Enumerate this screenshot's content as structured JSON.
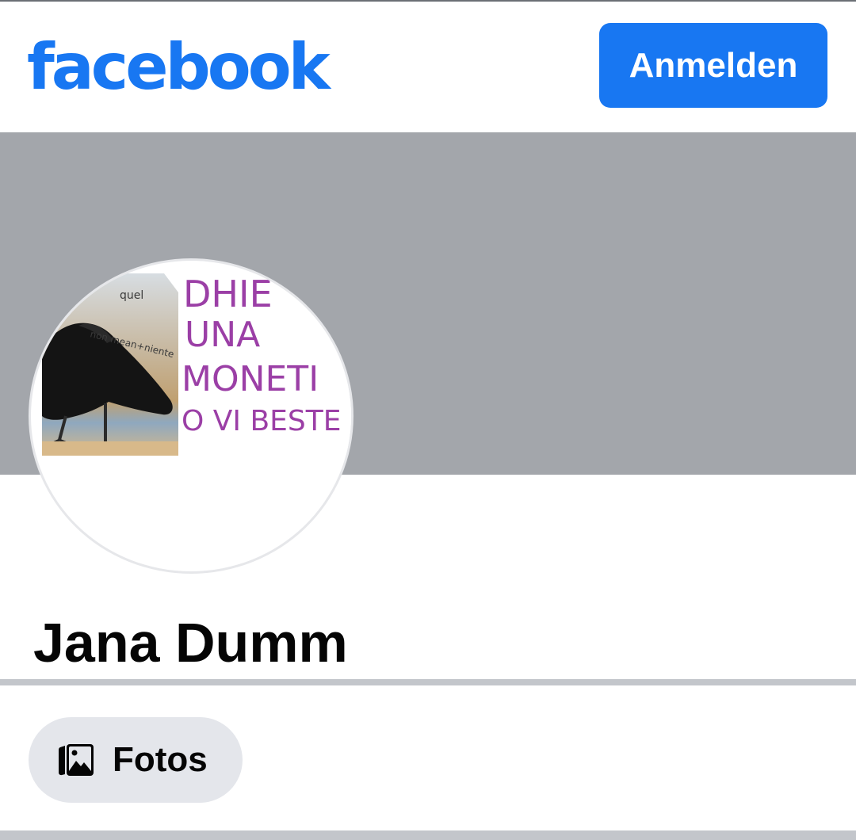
{
  "header": {
    "logo_text": "facebook",
    "login_label": "Anmelden"
  },
  "profile": {
    "name": "Jana Dumm",
    "avatar_handwriting": [
      "DHIE",
      "UNA",
      "MONETI",
      "O VI BESTE"
    ],
    "avatar_small_text": [
      "quel",
      "non mean+niente"
    ]
  },
  "tabs": {
    "photos_label": "Fotos"
  },
  "colors": {
    "brand_blue": "#1877f2",
    "cover_gray": "#a3a6ab",
    "pill_bg": "#e4e6eb",
    "divider_gray": "#c3c6cb",
    "handwriting_purple": "#9b3fa6"
  },
  "icons": {
    "photos": "photos-icon"
  }
}
